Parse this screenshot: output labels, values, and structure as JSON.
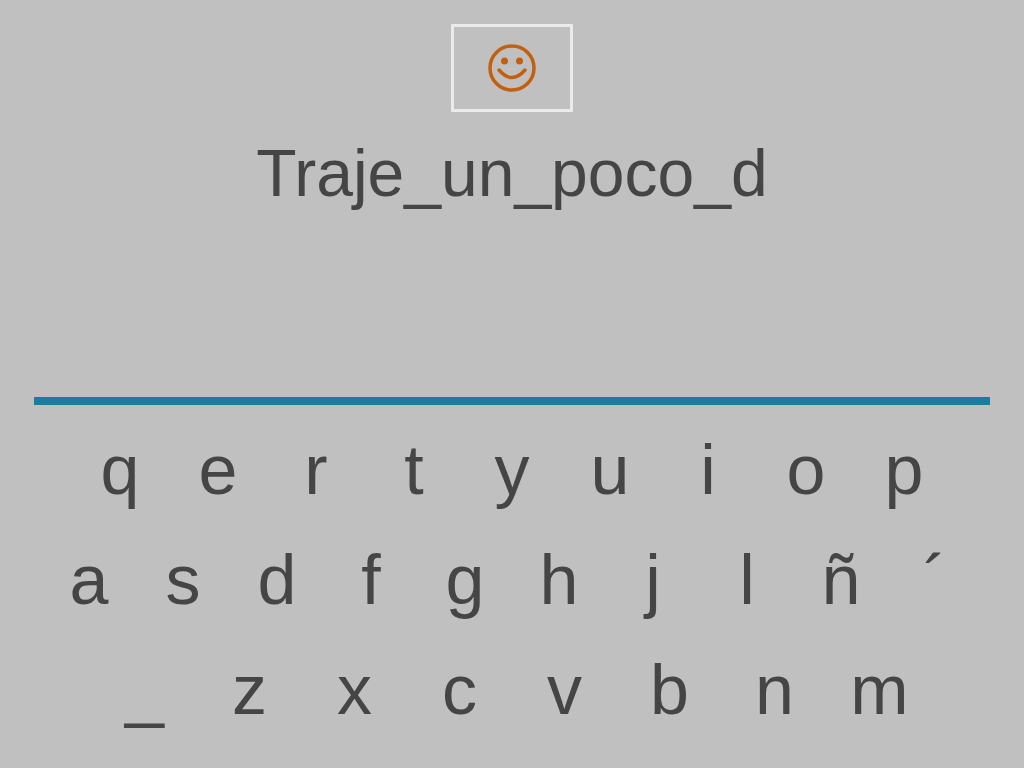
{
  "phrase": "Traje_un_poco_d",
  "keyboard": {
    "rows": [
      {
        "keys": [
          "q",
          "e",
          "r",
          "t",
          "y",
          "u",
          "i",
          "o",
          "p"
        ]
      },
      {
        "keys": [
          "a",
          "s",
          "d",
          "f",
          "g",
          "h",
          "j",
          "l",
          "ñ",
          "´"
        ]
      },
      {
        "keys": [
          "_",
          "z",
          "x",
          "c",
          "v",
          "b",
          "n",
          "m"
        ]
      }
    ]
  }
}
